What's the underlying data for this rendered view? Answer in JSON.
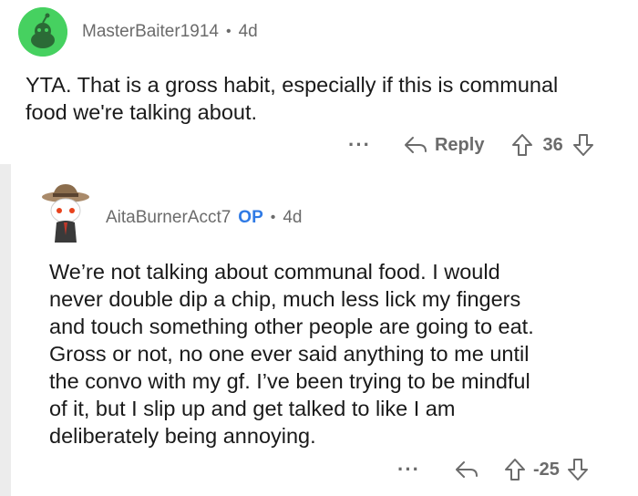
{
  "comment1": {
    "username": "MasterBaiter1914",
    "age": "4d",
    "text_lines": [
      "YTA. That is a gross habit, especially if this is communal",
      "food we're talking about."
    ],
    "more": "···",
    "reply_label": "Reply",
    "score": "36",
    "avatar_bg": "#46d160"
  },
  "comment2": {
    "username": "AitaBurnerAcct7",
    "op_badge": "OP",
    "age": "4d",
    "text_lines": [
      "We’re not talking about communal food. I would",
      "never double dip a chip, much less lick my fingers",
      "and touch something other people are going to eat.",
      "Gross or not, no one ever said anything to me until",
      "the convo with my gf. I’ve been trying to be mindful",
      "of it, but I slip up and get talked to like I am",
      "deliberately being annoying."
    ],
    "more": "···",
    "score": "-25",
    "op_color": "#2f7ae5"
  },
  "separator": "•"
}
